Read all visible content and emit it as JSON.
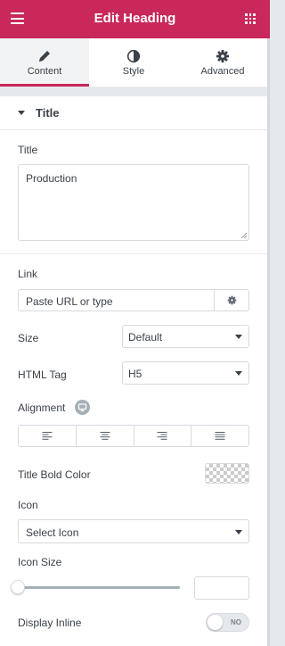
{
  "header": {
    "title": "Edit Heading"
  },
  "tabs": [
    {
      "label": "Content",
      "icon": "pencil-icon",
      "active": true
    },
    {
      "label": "Style",
      "icon": "half-circle-icon",
      "active": false
    },
    {
      "label": "Advanced",
      "icon": "gear-icon",
      "active": false
    }
  ],
  "section": {
    "title": "Title"
  },
  "title_field": {
    "label": "Title",
    "value": "Production"
  },
  "link_field": {
    "label": "Link",
    "placeholder": "Paste URL or type"
  },
  "size_field": {
    "label": "Size",
    "value": "Default"
  },
  "html_tag_field": {
    "label": "HTML Tag",
    "value": "H5"
  },
  "alignment_field": {
    "label": "Alignment",
    "options": [
      "left",
      "center",
      "right",
      "justify"
    ]
  },
  "title_bold_color_field": {
    "label": "Title Bold Color"
  },
  "icon_field": {
    "label": "Icon",
    "placeholder": "Select Icon"
  },
  "icon_size_field": {
    "label": "Icon Size",
    "value": ""
  },
  "display_inline_field": {
    "label": "Display Inline",
    "toggle_text": "NO"
  },
  "colors": {
    "brand": "#c8285a",
    "text": "#3b4148",
    "border": "#d5dadf"
  }
}
